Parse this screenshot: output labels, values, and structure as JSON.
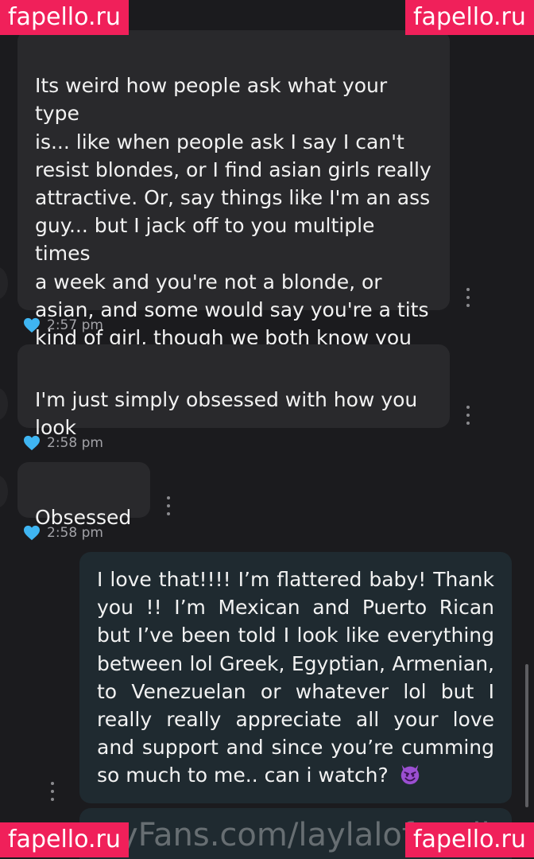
{
  "messages": [
    {
      "text": "Its weird how people ask what your type\nis... like when people ask I say I can't\nresist blondes, or I find asian girls really\nattractive. Or, say things like I'm an ass\nguy... but I jack off to you multiple times\na week and you're not a blonde, or\nasian, and some would say you're a tits\nkind of girl, though we both know you\nhave so many more assets.",
      "time": "2:57 pm"
    },
    {
      "text": "I'm just simply obsessed with how you\nlook",
      "time": "2:58 pm"
    },
    {
      "text": "Obsessed",
      "time": "2:58 pm"
    },
    {
      "text": "I love that!!!! I’m flattered baby! Thank you !! I’m Mexican and Puerto Rican but I’ve been told I look like everything between lol Greek, Egyptian, Armenian, to Venezuelan or whatever lol but I really really appreciate all your love and support and since you’re cumming so much to me.. can i watch?",
      "emoji": "smiling-imp"
    }
  ],
  "watermarks": {
    "corner_text": "fapello.ru",
    "site_text": "yFans.com/laylalofapello.ru"
  },
  "colors": {
    "background": "#1b1b1e",
    "incoming_bubble": "#29292c",
    "outgoing_bubble": "#1f2a30",
    "heart": "#3fb5f2",
    "watermark": "#f0205a"
  }
}
